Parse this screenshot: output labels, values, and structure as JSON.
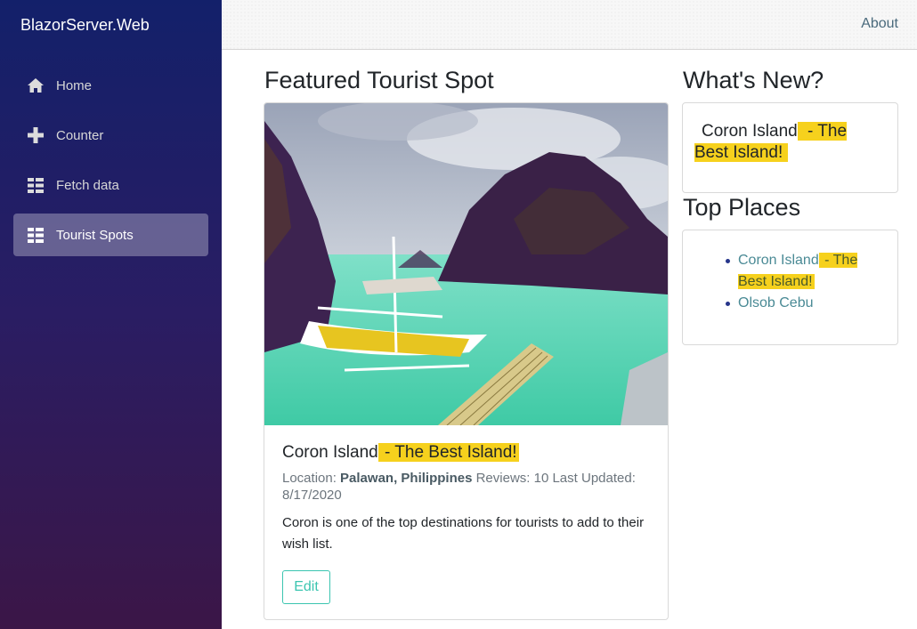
{
  "app": {
    "brand": "BlazorServer.Web"
  },
  "sidebar": {
    "items": [
      {
        "label": "Home",
        "icon": "home-icon",
        "active": false
      },
      {
        "label": "Counter",
        "icon": "plus-icon",
        "active": false
      },
      {
        "label": "Fetch data",
        "icon": "list-icon",
        "active": false
      },
      {
        "label": "Tourist Spots",
        "icon": "list-icon",
        "active": true
      }
    ]
  },
  "topbar": {
    "about": "About"
  },
  "featured": {
    "heading": "Featured Tourist Spot",
    "image_icon": "island-photo",
    "name": "Coron Island",
    "tagline": " - The Best Island!",
    "location_label": "Location: ",
    "location": "Palawan, Philippines",
    "reviews_label": " Reviews: ",
    "reviews": "10",
    "updated_label": " Last Updated: ",
    "updated": "8/17/2020",
    "description": "Coron is one of the top destinations for tourists to add to their wish list.",
    "edit_label": "Edit"
  },
  "whats_new": {
    "heading": "What's New?",
    "name": "Coron Island",
    "tagline": " - The Best Island!"
  },
  "top_places": {
    "heading": "Top Places",
    "items": [
      {
        "name": "Coron Island",
        "tagline": " - The Best Island!"
      },
      {
        "name": "Olsob Cebu",
        "tagline": ""
      }
    ]
  },
  "colors": {
    "highlight": "#f6d11d",
    "accent": "#3bc5b0",
    "link": "#4a8a95"
  }
}
